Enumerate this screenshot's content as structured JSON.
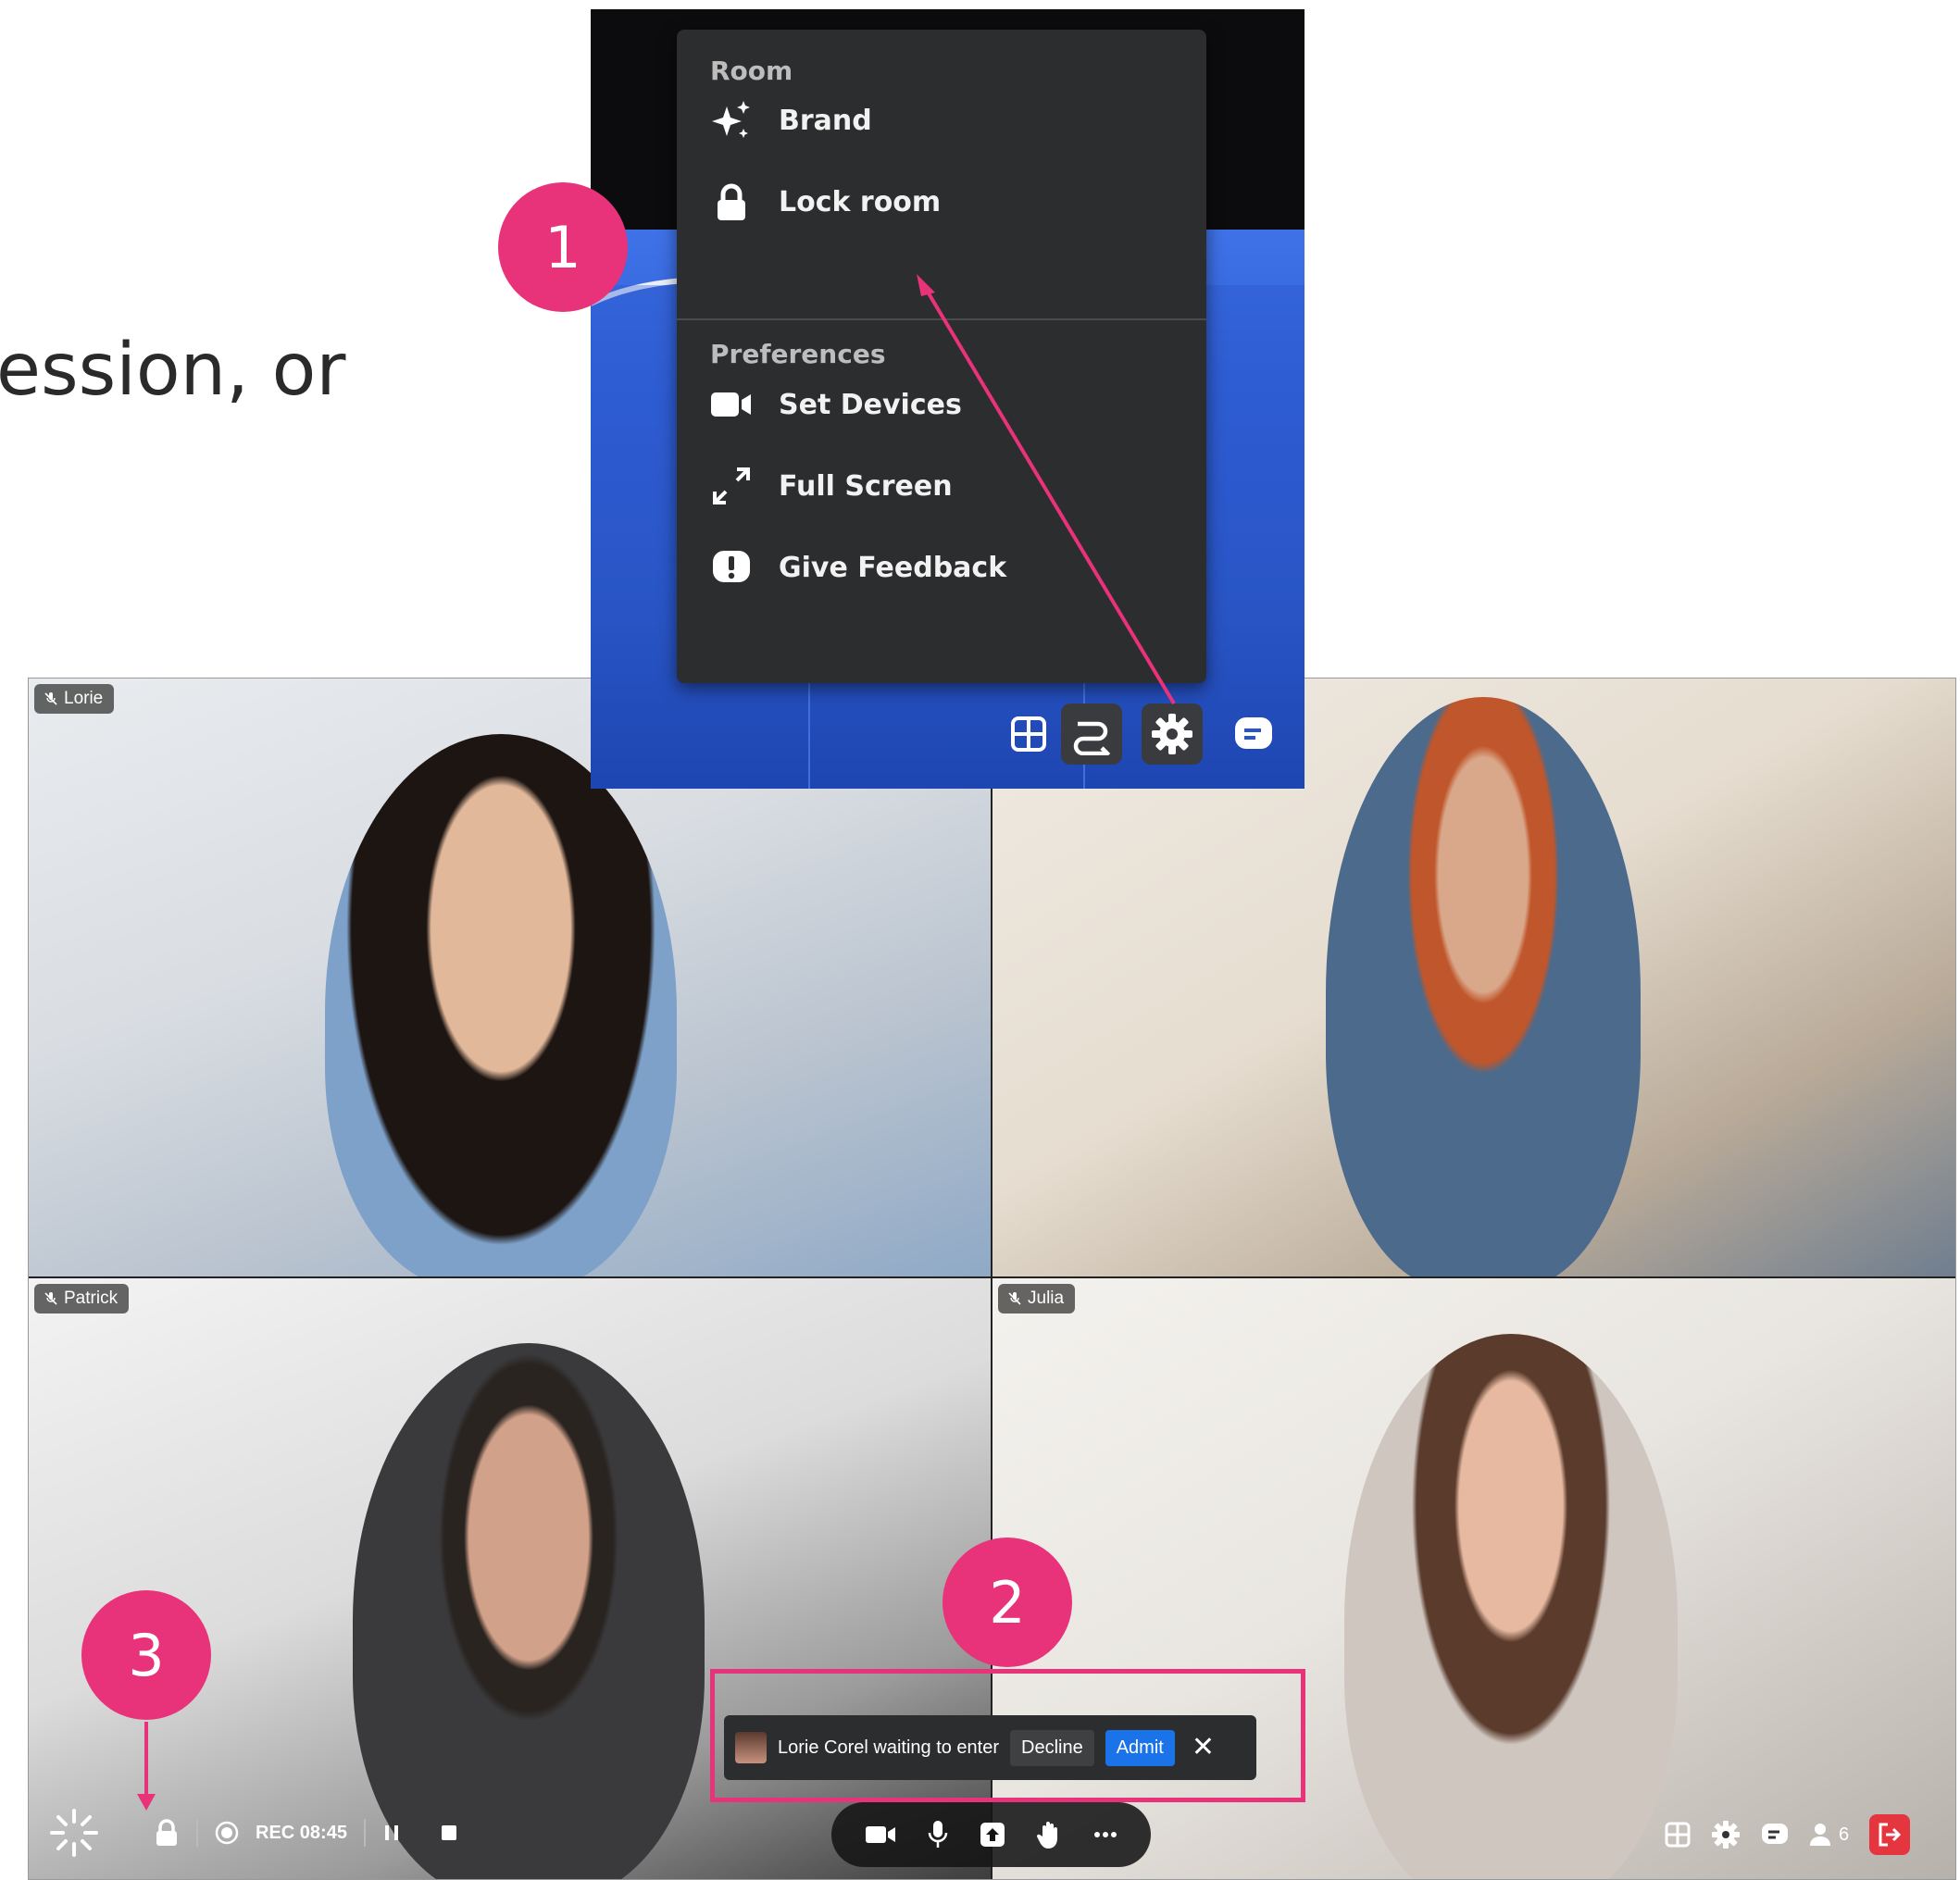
{
  "background_text": "ession, or",
  "popup": {
    "section_room": "Room",
    "items_room": [
      {
        "label": "Brand",
        "icon": "sparkles-icon"
      },
      {
        "label": "Lock room",
        "icon": "lock-icon"
      }
    ],
    "section_preferences": "Preferences",
    "items_preferences": [
      {
        "label": "Set Devices",
        "icon": "camera-icon"
      },
      {
        "label": "Full Screen",
        "icon": "fullscreen-icon"
      },
      {
        "label": "Give Feedback",
        "icon": "feedback-icon"
      }
    ],
    "toolbar_icons": [
      "grid-icon",
      "flow-icon",
      "gear-icon",
      "chat-icon"
    ]
  },
  "participants": [
    {
      "name": "Lorie"
    },
    {
      "name": ""
    },
    {
      "name": "Patrick"
    },
    {
      "name": "Julia"
    }
  ],
  "notification": {
    "message": "Lorie Corel waiting to enter",
    "decline_label": "Decline",
    "admit_label": "Admit",
    "close_label": "✕"
  },
  "toolbar": {
    "rec_label": "REC 08:45",
    "participant_count": "6"
  },
  "badges": [
    "1",
    "2",
    "3"
  ],
  "colors": {
    "accent_pink": "#e8327a",
    "admit_blue": "#1a73e8",
    "leave_red": "#e5353f",
    "popup_blue": "#3f72e8"
  }
}
